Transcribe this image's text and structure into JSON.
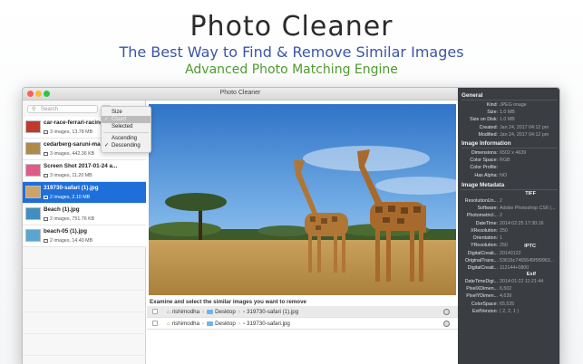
{
  "promo": {
    "title": "Photo Cleaner",
    "subtitle": "The Best Way to Find & Remove Similar Images",
    "tagline": "Advanced Photo Matching Engine"
  },
  "window": {
    "title": "Photo Cleaner"
  },
  "search": {
    "placeholder": "Search"
  },
  "sort_menu": {
    "items": [
      "Size",
      "Count",
      "Selected",
      "Ascending",
      "Descending"
    ],
    "highlighted": "Count",
    "checked": [
      "Count",
      "Descending"
    ]
  },
  "groups": [
    {
      "name": "car-race-ferrari-racing",
      "meta": "3 images, 13.78 MB",
      "thumb_color": "#c0392b"
    },
    {
      "name": "cedarberg-saruni-mara",
      "meta": "3 images, 442.36 KB",
      "thumb_color": "#b08a4a"
    },
    {
      "name": "Screen Shot 2017-01-24 a...",
      "meta": "3 images, 11.20 MB",
      "thumb_color": "#e05a8a"
    },
    {
      "name": "319730-safari (1).jpg",
      "meta": "2 images, 2.10 MB",
      "thumb_color": "#caa46a",
      "selected": true
    },
    {
      "name": "Beach (1).jpg",
      "meta": "2 images, 751.76 KB",
      "thumb_color": "#3f8fc0"
    },
    {
      "name": "beach-05 (1).jpg",
      "meta": "2 images, 14.40 MB",
      "thumb_color": "#5aa6cf"
    }
  ],
  "main": {
    "instruction": "Examine and select the similar images you want to remove",
    "rows": [
      {
        "user": "rishimodha",
        "folder": "Desktop",
        "file": "319730-safari (1).jpg"
      },
      {
        "user": "rishimodha",
        "folder": "Desktop",
        "file": "319730-safari.jpg"
      }
    ]
  },
  "inspector": {
    "general_title": "General",
    "general": [
      {
        "k": "Kind:",
        "v": "JPEG image"
      },
      {
        "k": "Size:",
        "v": "1.0 MB"
      },
      {
        "k": "Size on Disk:",
        "v": "1.0 MB"
      },
      {
        "k": "Created:",
        "v": "Jan 24, 2017 04:12 pm"
      },
      {
        "k": "Modified:",
        "v": "Jan 24, 2017 04:12 pm"
      }
    ],
    "info_title": "Image Information",
    "info": [
      {
        "k": "Dimensions:",
        "v": "6502 x 4639"
      },
      {
        "k": "Color Space:",
        "v": "RGB"
      },
      {
        "k": "Color Profile:",
        "v": ""
      },
      {
        "k": "Has Alpha:",
        "v": "NO"
      }
    ],
    "meta_title": "Image Metadata",
    "tiff_title": "TIFF",
    "tiff": [
      {
        "k": "ResolutionUn...",
        "v": "2"
      },
      {
        "k": "Software:",
        "v": "Adobe Photoshop CS6 (..."
      },
      {
        "k": "PhotometricI...",
        "v": "2"
      },
      {
        "k": "DateTime:",
        "v": "2014:02:25 17:30:16"
      },
      {
        "k": "XResolution:",
        "v": "250"
      },
      {
        "k": "Orientation:",
        "v": "1"
      },
      {
        "k": "YResolution:",
        "v": "250"
      }
    ],
    "iptc_title": "IPTC",
    "iptc": [
      {
        "k": "DigitalCreati...",
        "v": "20140122"
      },
      {
        "k": "OriginalTrans...",
        "v": "53616c7465645f5f9963..."
      },
      {
        "k": "DigitalCreati...",
        "v": "112144+0800"
      }
    ],
    "exif_title": "Exif",
    "exif": [
      {
        "k": "DateTimeDigi...",
        "v": "2014:01:22 11:21:44"
      },
      {
        "k": "PixelXDimen...",
        "v": "6,502"
      },
      {
        "k": "PixelYDimen...",
        "v": "4,639"
      },
      {
        "k": "ColorSpace:",
        "v": "65,535"
      },
      {
        "k": "ExifVersion:",
        "v": "( 2, 2, 1 )"
      }
    ]
  }
}
